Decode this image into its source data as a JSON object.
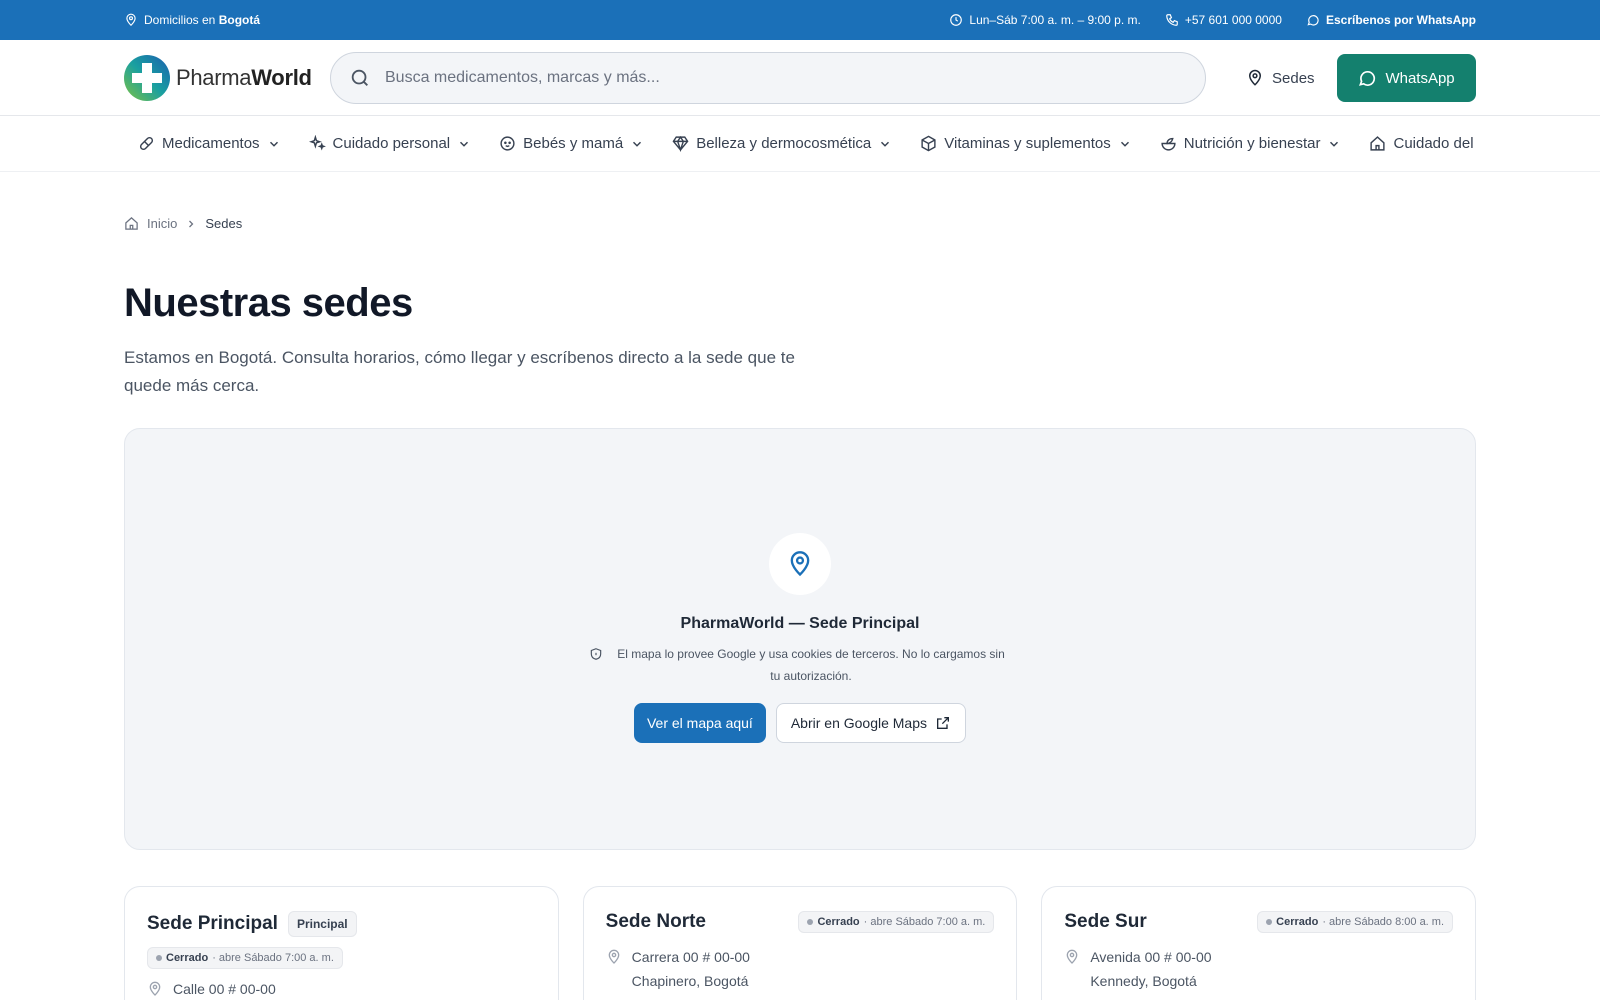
{
  "topbar": {
    "delivery_prefix": "Domicilios en ",
    "delivery_city": "Bogotá",
    "hours": "Lun–Sáb 7:00 a. m. – 9:00 p. m.",
    "phone": "+57 601 000 0000",
    "whatsapp": "Escríbenos por WhatsApp"
  },
  "header": {
    "logo_part1": "Pharma",
    "logo_part2": "World",
    "search_placeholder": "Busca medicamentos, marcas y más...",
    "sedes_label": "Sedes",
    "whatsapp_label": "WhatsApp"
  },
  "nav": {
    "items": [
      {
        "label": "Medicamentos",
        "icon": "pill-icon"
      },
      {
        "label": "Cuidado personal",
        "icon": "sparkles-icon"
      },
      {
        "label": "Bebés y mamá",
        "icon": "baby-icon"
      },
      {
        "label": "Belleza y dermocosmética",
        "icon": "gem-icon"
      },
      {
        "label": "Vitaminas y suplementos",
        "icon": "box-icon"
      },
      {
        "label": "Nutrición y bienestar",
        "icon": "salad-icon"
      },
      {
        "label": "Cuidado del h",
        "icon": "home-icon"
      }
    ]
  },
  "breadcrumb": {
    "home": "Inicio",
    "current": "Sedes"
  },
  "page": {
    "title": "Nuestras sedes",
    "lead": "Estamos en Bogotá. Consulta horarios, cómo llegar y escríbenos directo a la sede que te quede más cerca."
  },
  "map": {
    "title": "PharmaWorld — Sede Principal",
    "note": "El mapa lo provee Google y usa cookies de terceros. No lo cargamos sin tu autorización.",
    "view_button": "Ver el mapa aquí",
    "open_button": "Abrir en Google Maps"
  },
  "sedes": [
    {
      "name": "Sede Principal",
      "tag": "Principal",
      "status": "Cerrado",
      "opens": "· abre Sábado 7:00 a. m.",
      "address1": "Calle 00 # 00-00",
      "address2": ""
    },
    {
      "name": "Sede Norte",
      "tag": "",
      "status": "Cerrado",
      "opens": "· abre Sábado 7:00 a. m.",
      "address1": "Carrera 00 # 00-00",
      "address2": "Chapinero, Bogotá"
    },
    {
      "name": "Sede Sur",
      "tag": "",
      "status": "Cerrado",
      "opens": "· abre Sábado 8:00 a. m.",
      "address1": "Avenida 00 # 00-00",
      "address2": "Kennedy, Bogotá"
    }
  ],
  "colors": {
    "primary": "#1b70b8",
    "whatsapp": "#14806e"
  }
}
